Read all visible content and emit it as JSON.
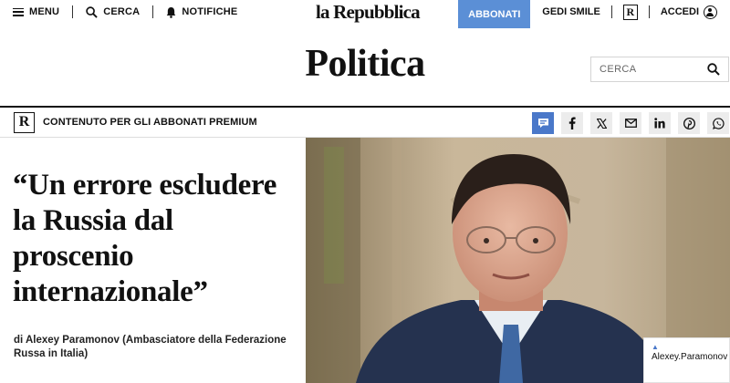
{
  "topbar": {
    "menu_label": "MENU",
    "search_label": "CERCA",
    "notifications_label": "NOTIFICHE",
    "logo": "la Repubblica",
    "subscribe_label": "ABBONATI",
    "gedi_label": "GEDI SMILE",
    "r_badge": "R",
    "login_label": "ACCEDI"
  },
  "section": {
    "title": "Politica",
    "search_placeholder": "CERCA"
  },
  "premium": {
    "badge": "R",
    "label": "CONTENUTO PER GLI ABBONATI PREMIUM"
  },
  "share": {
    "icons": [
      "comments-icon",
      "facebook-icon",
      "x-icon",
      "email-icon",
      "linkedin-icon",
      "pinterest-icon",
      "whatsapp-icon"
    ]
  },
  "article": {
    "headline_lines": [
      "“Un errore escludere",
      "la Russia dal",
      "proscenio",
      "internazionale”"
    ],
    "byline_1": "di Alexey Paramonov (Ambasciatore della Federazione",
    "byline_2": "Russa in Italia)"
  },
  "photo": {
    "caption": "Alexey.Paramonov"
  },
  "colors": {
    "accent": "#5b8fd6",
    "share_active": "#4a78c9"
  }
}
